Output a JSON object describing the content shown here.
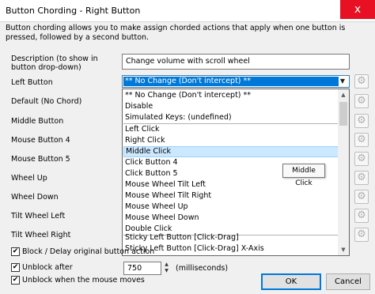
{
  "window": {
    "title": "Button Chording - Right Button",
    "close_glyph": "x"
  },
  "description": "Button chording allows you to make assign chorded actions that apply when one button is pressed, followed by a second button.",
  "fields": {
    "description_label": "Description (to show in button drop-down)",
    "description_value": "Change volume with scroll wheel"
  },
  "rows": [
    {
      "label": "Left Button"
    },
    {
      "label": "Default (No Chord)"
    },
    {
      "label": "Middle Button"
    },
    {
      "label": "Mouse Button 4"
    },
    {
      "label": "Mouse Button 5"
    },
    {
      "label": "Wheel Up"
    },
    {
      "label": "Wheel Down"
    },
    {
      "label": "Tilt Wheel Left"
    },
    {
      "label": "Tilt Wheel Right"
    }
  ],
  "combo": {
    "selected": "** No Change (Don't intercept) **",
    "arrow_icon": "chevron-down-icon"
  },
  "dropdown": {
    "items": [
      "** No Change (Don't intercept) **",
      "Disable",
      "Simulated Keys: (undefined)",
      "Left Click",
      "Right Click",
      "Middle Click",
      "Click Button 4",
      "Click Button 5",
      "Mouse Wheel Tilt Left",
      "Mouse Wheel Tilt Right",
      "Mouse Wheel Up",
      "Mouse Wheel Down",
      "Double Click",
      "Sticky Left Button [Click-Drag]",
      "Sticky Left Button [Click-Drag] X-Axis"
    ],
    "hover_item": "Middle Click"
  },
  "tooltip": "Middle Click",
  "options": {
    "block_label": "Block / Delay original button action",
    "block_checked": true,
    "unblock_after_label": "Unblock after",
    "unblock_after_checked": true,
    "unblock_after_value": "750",
    "unblock_after_unit": "(milliseconds)",
    "unblock_moves_label": "Unblock when the mouse moves",
    "unblock_moves_checked": true
  },
  "buttons": {
    "ok": "OK",
    "cancel": "Cancel"
  },
  "colors": {
    "accent": "#0078d7",
    "close": "#e81123",
    "hover": "#cce8ff"
  }
}
